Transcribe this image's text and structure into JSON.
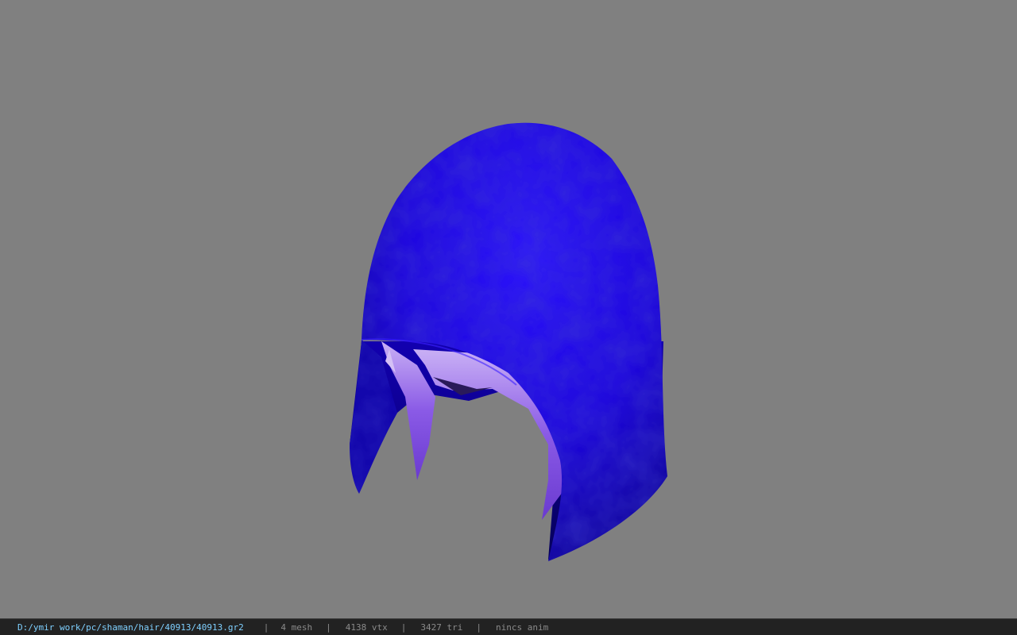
{
  "viewer": {
    "background_color": "#808080",
    "model_colors": {
      "hood": "#1a00e6",
      "hood_shadow": "#0a0070",
      "hair": "#8a5ae6"
    }
  },
  "status_bar": {
    "file_path": "D:/ymir work/pc/shaman/hair/40913/40913.gr2",
    "mesh_count": "4 mesh",
    "vertex_count": "4138 vtx",
    "triangle_count": "3427 tri",
    "anim_status": "nincs anim",
    "separator": "|"
  }
}
